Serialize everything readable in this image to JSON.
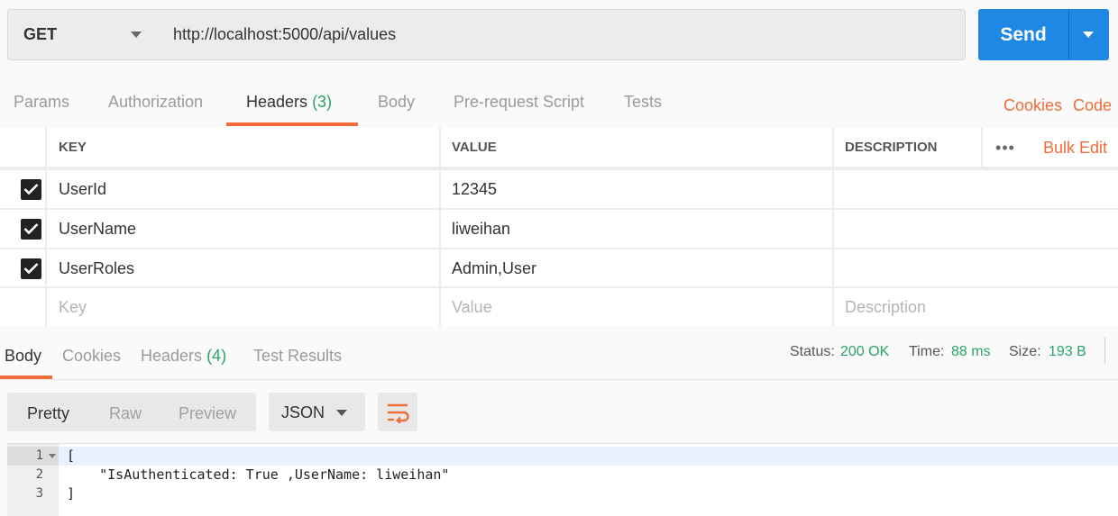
{
  "request": {
    "method": "GET",
    "url": "http://localhost:5000/api/values",
    "send_label": "Send"
  },
  "request_tabs": {
    "params": "Params",
    "authorization": "Authorization",
    "headers": "Headers",
    "headers_count": "(3)",
    "body": "Body",
    "prerequest": "Pre-request Script",
    "tests": "Tests",
    "active": "Headers",
    "cookies_link": "Cookies",
    "code_link": "Code"
  },
  "headers_table": {
    "columns": [
      "KEY",
      "VALUE",
      "DESCRIPTION"
    ],
    "more_icon": "more-horizontal-icon",
    "bulk_edit": "Bulk Edit",
    "rows": [
      {
        "checked": true,
        "key": "UserId",
        "value": "12345",
        "description": ""
      },
      {
        "checked": true,
        "key": "UserName",
        "value": "liweihan",
        "description": ""
      },
      {
        "checked": true,
        "key": "UserRoles",
        "value": "Admin,User",
        "description": ""
      }
    ],
    "placeholders": {
      "key": "Key",
      "value": "Value",
      "description": "Description"
    }
  },
  "response_tabs": {
    "body": "Body",
    "cookies": "Cookies",
    "headers": "Headers",
    "headers_count": "(4)",
    "test_results": "Test Results",
    "active": "Body"
  },
  "status": {
    "status_label": "Status:",
    "status_value": "200 OK",
    "time_label": "Time:",
    "time_value": "88 ms",
    "size_label": "Size:",
    "size_value": "193 B"
  },
  "format_toolbar": {
    "views": [
      "Pretty",
      "Raw",
      "Preview"
    ],
    "active_view": "Pretty",
    "language": "JSON",
    "wrap_icon": "wrap-lines-icon"
  },
  "editor": {
    "lines": [
      {
        "number": "1",
        "text": "["
      },
      {
        "number": "2",
        "text": "    \"IsAuthenticated: True ,UserName: liweihan\""
      },
      {
        "number": "3",
        "text": "]"
      }
    ]
  },
  "colors": {
    "accent": "#f26b3a",
    "send_button": "#1f88e5",
    "success": "#2aa36b"
  }
}
